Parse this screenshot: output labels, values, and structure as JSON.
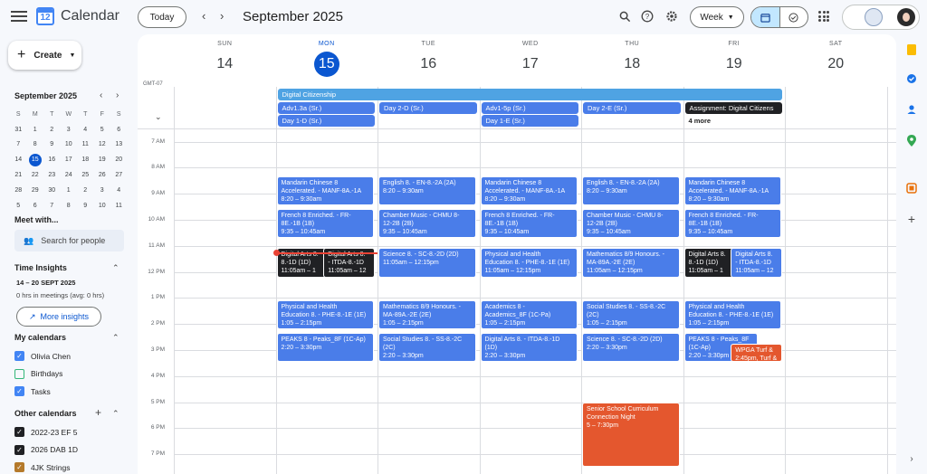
{
  "header": {
    "app_title": "Calendar",
    "logo_number": "12",
    "today_label": "Today",
    "month_label": "September 2025",
    "view_label": "Week"
  },
  "sidebar": {
    "create_label": "Create",
    "mini_cal": {
      "title": "September 2025",
      "weekdays": [
        "S",
        "M",
        "T",
        "W",
        "T",
        "F",
        "S"
      ],
      "weeks": [
        [
          "31",
          "1",
          "2",
          "3",
          "4",
          "5",
          "6"
        ],
        [
          "7",
          "8",
          "9",
          "10",
          "11",
          "12",
          "13"
        ],
        [
          "14",
          "15",
          "16",
          "17",
          "18",
          "19",
          "20"
        ],
        [
          "21",
          "22",
          "23",
          "24",
          "25",
          "26",
          "27"
        ],
        [
          "28",
          "29",
          "30",
          "1",
          "2",
          "3",
          "4"
        ],
        [
          "5",
          "6",
          "7",
          "8",
          "9",
          "10",
          "11"
        ]
      ],
      "today": "15"
    },
    "meet_with": "Meet with...",
    "search_people": "Search for people",
    "time_insights": "Time Insights",
    "insights_range": "14 – 20 SEPT 2025",
    "insights_sub": "0 hrs in meetings (avg: 0 hrs)",
    "more_insights": "More insights",
    "my_calendars_title": "My calendars",
    "my_calendars": [
      {
        "label": "Olivia Chen",
        "color": "#4285f4",
        "checked": true
      },
      {
        "label": "Birthdays",
        "color": "#33b679",
        "checked": false
      },
      {
        "label": "Tasks",
        "color": "#4285f4",
        "checked": true
      }
    ],
    "other_calendars_title": "Other calendars",
    "other_calendars": [
      {
        "label": "2022-23 EF 5",
        "color": "#202124",
        "checked": true
      },
      {
        "label": "2026 DAB 1D",
        "color": "#202124",
        "checked": true
      },
      {
        "label": "4JK Strings",
        "color": "#b57a2b",
        "checked": true
      }
    ]
  },
  "calendar": {
    "timezone": "GMT-07",
    "days": [
      {
        "name": "SUN",
        "num": "14",
        "today": false
      },
      {
        "name": "MON",
        "num": "15",
        "today": true
      },
      {
        "name": "TUE",
        "num": "16",
        "today": false
      },
      {
        "name": "WED",
        "num": "17",
        "today": false
      },
      {
        "name": "THU",
        "num": "18",
        "today": false
      },
      {
        "name": "FRI",
        "num": "19",
        "today": false
      },
      {
        "name": "SAT",
        "num": "20",
        "today": false
      }
    ],
    "hours": [
      "7 AM",
      "8 AM",
      "9 AM",
      "10 AM",
      "11 AM",
      "12 PM",
      "1 PM",
      "2 PM",
      "3 PM",
      "4 PM",
      "5 PM",
      "6 PM",
      "7 PM"
    ],
    "allday": [
      {
        "title": "Digital Citizenship",
        "day": 1,
        "span": 5,
        "row": 0,
        "color": "#4fa3e3"
      },
      {
        "title": "Adv1.3a (Sr.)",
        "day": 1,
        "span": 1,
        "row": 1,
        "color": "#4a7de9"
      },
      {
        "title": "Day 2-D (Sr.)",
        "day": 2,
        "span": 1,
        "row": 1,
        "color": "#4a7de9"
      },
      {
        "title": "Adv1-5p (Sr.)",
        "day": 3,
        "span": 1,
        "row": 1,
        "color": "#4a7de9"
      },
      {
        "title": "Day 2-E (Sr.)",
        "day": 4,
        "span": 1,
        "row": 1,
        "color": "#4a7de9"
      },
      {
        "title": "Assignment: Digital Citizens",
        "day": 5,
        "span": 1,
        "row": 1,
        "color": "#202124"
      },
      {
        "title": "Day 1-D (Sr.)",
        "day": 1,
        "span": 1,
        "row": 2,
        "color": "#4a7de9"
      },
      {
        "title": "Day 1-E (Sr.)",
        "day": 3,
        "span": 1,
        "row": 2,
        "color": "#4a7de9"
      }
    ],
    "more_label": "4 more",
    "events": [
      {
        "day": 1,
        "start": 8.33,
        "end": 9.5,
        "lines": [
          "Mandarin Chinese 8",
          "Accelerated. - MANF-8A.-1A",
          "8:20 – 9:30am"
        ],
        "kind": "blue"
      },
      {
        "day": 2,
        "start": 8.33,
        "end": 9.5,
        "lines": [
          "English 8. - EN-8.-2A (2A)",
          "8:20 – 9:30am"
        ],
        "kind": "blue"
      },
      {
        "day": 3,
        "start": 8.33,
        "end": 9.5,
        "lines": [
          "Mandarin Chinese 8",
          "Accelerated. - MANF-8A.-1A",
          "8:20 – 9:30am"
        ],
        "kind": "blue"
      },
      {
        "day": 4,
        "start": 8.33,
        "end": 9.5,
        "lines": [
          "English 8. - EN-8.-2A (2A)",
          "8:20 – 9:30am"
        ],
        "kind": "blue"
      },
      {
        "day": 5,
        "start": 8.33,
        "end": 9.5,
        "lines": [
          "Mandarin Chinese 8",
          "Accelerated. - MANF-8A.-1A",
          "8:20 – 9:30am"
        ],
        "kind": "blue"
      },
      {
        "day": 1,
        "start": 9.58,
        "end": 10.75,
        "lines": [
          "French 8 Enriched. - FR-",
          "8E.-1B (1B)",
          "9:35 – 10:45am"
        ],
        "kind": "blue"
      },
      {
        "day": 2,
        "start": 9.58,
        "end": 10.75,
        "lines": [
          "Chamber Music - CHMU 8-",
          "12-2B (2B)",
          "9:35 – 10:45am"
        ],
        "kind": "blue"
      },
      {
        "day": 3,
        "start": 9.58,
        "end": 10.75,
        "lines": [
          "French 8 Enriched. - FR-",
          "8E.-1B (1B)",
          "9:35 – 10:45am"
        ],
        "kind": "blue"
      },
      {
        "day": 4,
        "start": 9.58,
        "end": 10.75,
        "lines": [
          "Chamber Music - CHMU 8-",
          "12-2B (2B)",
          "9:35 – 10:45am"
        ],
        "kind": "blue"
      },
      {
        "day": 5,
        "start": 9.58,
        "end": 10.75,
        "lines": [
          "French 8 Enriched. - FR-",
          "8E.-1B (1B)",
          "9:35 – 10:45am"
        ],
        "kind": "blue"
      },
      {
        "day": 1,
        "start": 11.08,
        "end": 12.25,
        "lines": [
          "Digital Arts 8.",
          "8.-1D (1D)",
          "11:05am – 1"
        ],
        "kind": "dark",
        "half": "left"
      },
      {
        "day": 1,
        "start": 11.08,
        "end": 12.25,
        "lines": [
          "Digital Arts 8.",
          "- ITDA-8.-1D",
          "11:05am – 12"
        ],
        "kind": "dark",
        "half": "right"
      },
      {
        "day": 2,
        "start": 11.08,
        "end": 12.25,
        "lines": [
          "Science 8. - SC-8.-2D (2D)",
          "11:05am – 12:15pm"
        ],
        "kind": "blue"
      },
      {
        "day": 3,
        "start": 11.08,
        "end": 12.25,
        "lines": [
          "Physical and Health",
          "Education 8. - PHE-8.-1E (1E)",
          "11:05am – 12:15pm"
        ],
        "kind": "blue"
      },
      {
        "day": 4,
        "start": 11.08,
        "end": 12.25,
        "lines": [
          "Mathematics 8/9 Honours. -",
          "MA-89A.-2E (2E)",
          "11:05am – 12:15pm"
        ],
        "kind": "blue"
      },
      {
        "day": 5,
        "start": 11.08,
        "end": 12.25,
        "lines": [
          "Digital Arts 8.",
          "8.-1D (1D)",
          "11:05am – 1"
        ],
        "kind": "dark",
        "half": "left"
      },
      {
        "day": 5,
        "start": 11.08,
        "end": 12.25,
        "lines": [
          "Digital Arts 8.",
          "- ITDA-8.-1D",
          "11:05am – 12"
        ],
        "kind": "blue",
        "half": "right"
      },
      {
        "day": 1,
        "start": 13.08,
        "end": 14.25,
        "lines": [
          "Physical and Health",
          "Education 8. - PHE-8.-1E (1E)",
          "1:05 – 2:15pm"
        ],
        "kind": "blue"
      },
      {
        "day": 2,
        "start": 13.08,
        "end": 14.25,
        "lines": [
          "Mathematics 8/9 Honours. -",
          "MA-89A.-2E (2E)",
          "1:05 – 2:15pm"
        ],
        "kind": "blue"
      },
      {
        "day": 3,
        "start": 13.08,
        "end": 14.25,
        "lines": [
          "Academics 8 -",
          "Academics_8F (1C-Pa)",
          "1:05 – 2:15pm"
        ],
        "kind": "blue"
      },
      {
        "day": 4,
        "start": 13.08,
        "end": 14.25,
        "lines": [
          "Social Studies 8. - SS-8.-2C",
          "(2C)",
          "1:05 – 2:15pm"
        ],
        "kind": "blue"
      },
      {
        "day": 5,
        "start": 13.08,
        "end": 14.25,
        "lines": [
          "Physical and Health",
          "Education 8. - PHE-8.-1E (1E)",
          "1:05 – 2:15pm"
        ],
        "kind": "blue"
      },
      {
        "day": 1,
        "start": 14.33,
        "end": 15.5,
        "lines": [
          "PEAKS 8 - Peaks_8F (1C-Ap)",
          "2:20 – 3:30pm"
        ],
        "kind": "blue"
      },
      {
        "day": 2,
        "start": 14.33,
        "end": 15.5,
        "lines": [
          "Social Studies 8. - SS-8.-2C",
          "(2C)",
          "2:20 – 3:30pm"
        ],
        "kind": "blue"
      },
      {
        "day": 3,
        "start": 14.33,
        "end": 15.5,
        "lines": [
          "Digital Arts 8. - ITDA-8.-1D",
          "(1D)",
          "2:20 – 3:30pm"
        ],
        "kind": "blue"
      },
      {
        "day": 4,
        "start": 14.33,
        "end": 15.5,
        "lines": [
          "Science 8. - SC-8.-2D (2D)",
          "2:20 – 3:30pm"
        ],
        "kind": "blue"
      },
      {
        "day": 5,
        "start": 14.33,
        "end": 15.5,
        "lines": [
          "PEAKS 8 - Peaks_8F",
          "(1C-Ap)",
          "2:20 – 3:30pm"
        ],
        "kind": "blue",
        "half": "leftwide"
      },
      {
        "day": 5,
        "start": 14.75,
        "end": 15.5,
        "lines": [
          "WPGA Turf &",
          "2:45pm, Turf &"
        ],
        "kind": "orange",
        "half": "rightnarrow"
      },
      {
        "day": 4,
        "start": 17.0,
        "end": 19.5,
        "lines": [
          "Senior School Curriculum",
          "Connection Night",
          "5 – 7:30pm"
        ],
        "kind": "orange"
      }
    ]
  },
  "colors": {
    "accent": "#0b57d0",
    "event_blue": "#4a7de9",
    "event_dark": "#202124",
    "event_orange": "#e4572e",
    "now_line": "#ea4335"
  }
}
